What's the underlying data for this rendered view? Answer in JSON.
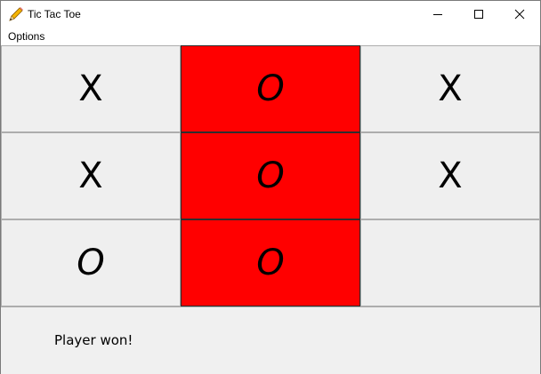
{
  "window": {
    "title": "Tic Tac Toe",
    "icon": "pencil-icon"
  },
  "menubar": {
    "options_label": "Options"
  },
  "board": {
    "rows": [
      [
        "X",
        "O",
        "X"
      ],
      [
        "X",
        "O",
        "X"
      ],
      [
        "O",
        "O",
        ""
      ]
    ],
    "winning_column": 1,
    "win_color": "#ff0000"
  },
  "status": {
    "text": "Player won!"
  }
}
